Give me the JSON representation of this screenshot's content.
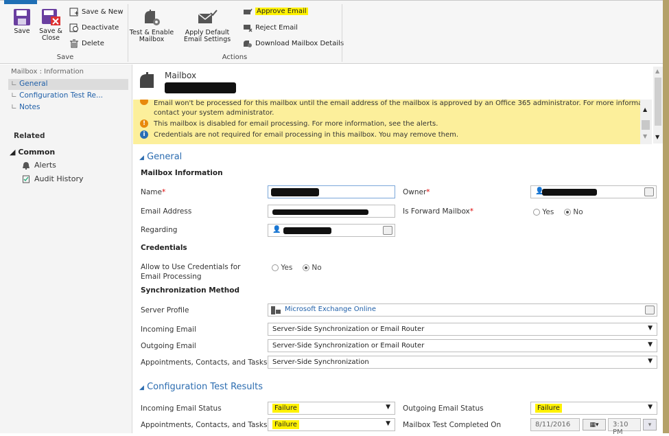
{
  "ribbon": {
    "save": {
      "label": "Save",
      "save_close": "Save & Close",
      "save_new": "Save & New",
      "deactivate": "Deactivate",
      "delete": "Delete",
      "group": "Save"
    },
    "actions": {
      "test_enable": "Test & Enable Mailbox",
      "apply_default": "Apply Default Email Settings",
      "approve": "Approve Email",
      "reject": "Reject Email",
      "download": "Download Mailbox Details",
      "group": "Actions"
    }
  },
  "leftnav": {
    "breadcrumb": "Mailbox : Information",
    "items": [
      "General",
      "Configuration Test Re...",
      "Notes"
    ],
    "related": "Related",
    "common": "Common",
    "common_items": [
      "Alerts",
      "Audit History"
    ]
  },
  "header": {
    "entity": "Mailbox"
  },
  "alerts": [
    "Email won't be processed for this mailbox until the email address of the mailbox is approved by an Office 365 administrator. For more information,",
    "contact your system administrator.",
    "This mailbox is disabled for email processing. For more information, see the alerts.",
    "Credentials are not required for email processing in this mailbox. You may remove them."
  ],
  "general": {
    "title": "General",
    "mailbox_info": "Mailbox Information",
    "name_label": "Name",
    "owner_label": "Owner",
    "email_label": "Email Address",
    "forward_label": "Is Forward Mailbox",
    "forward_yes": "Yes",
    "forward_no": "No",
    "regarding_label": "Regarding",
    "credentials": "Credentials",
    "allow_creds_label": "Allow to Use Credentials for Email Processing",
    "creds_yes": "Yes",
    "creds_no": "No",
    "sync_method": "Synchronization Method",
    "server_profile_label": "Server Profile",
    "server_profile_value": "Microsoft Exchange Online",
    "incoming_label": "Incoming Email",
    "incoming_value": "Server-Side Synchronization or Email Router",
    "outgoing_label": "Outgoing Email",
    "outgoing_value": "Server-Side Synchronization or Email Router",
    "appts_label": "Appointments, Contacts, and Tasks",
    "appts_value": "Server-Side Synchronization"
  },
  "config": {
    "title": "Configuration Test Results",
    "incoming_status_label": "Incoming Email Status",
    "incoming_status_value": "Failure",
    "outgoing_status_label": "Outgoing Email Status",
    "outgoing_status_value": "Failure",
    "appts_status_label": "Appointments, Contacts, and Tasks",
    "appts_status_value": "Failure",
    "test_completed_label": "Mailbox Test Completed On",
    "test_date": "8/11/2016",
    "test_time": "3:10 PM"
  },
  "colors": {
    "highlight": "#fff200",
    "alert_bg": "#fcef9b",
    "accent": "#2b6cb0",
    "link": "#1f5fa8"
  }
}
